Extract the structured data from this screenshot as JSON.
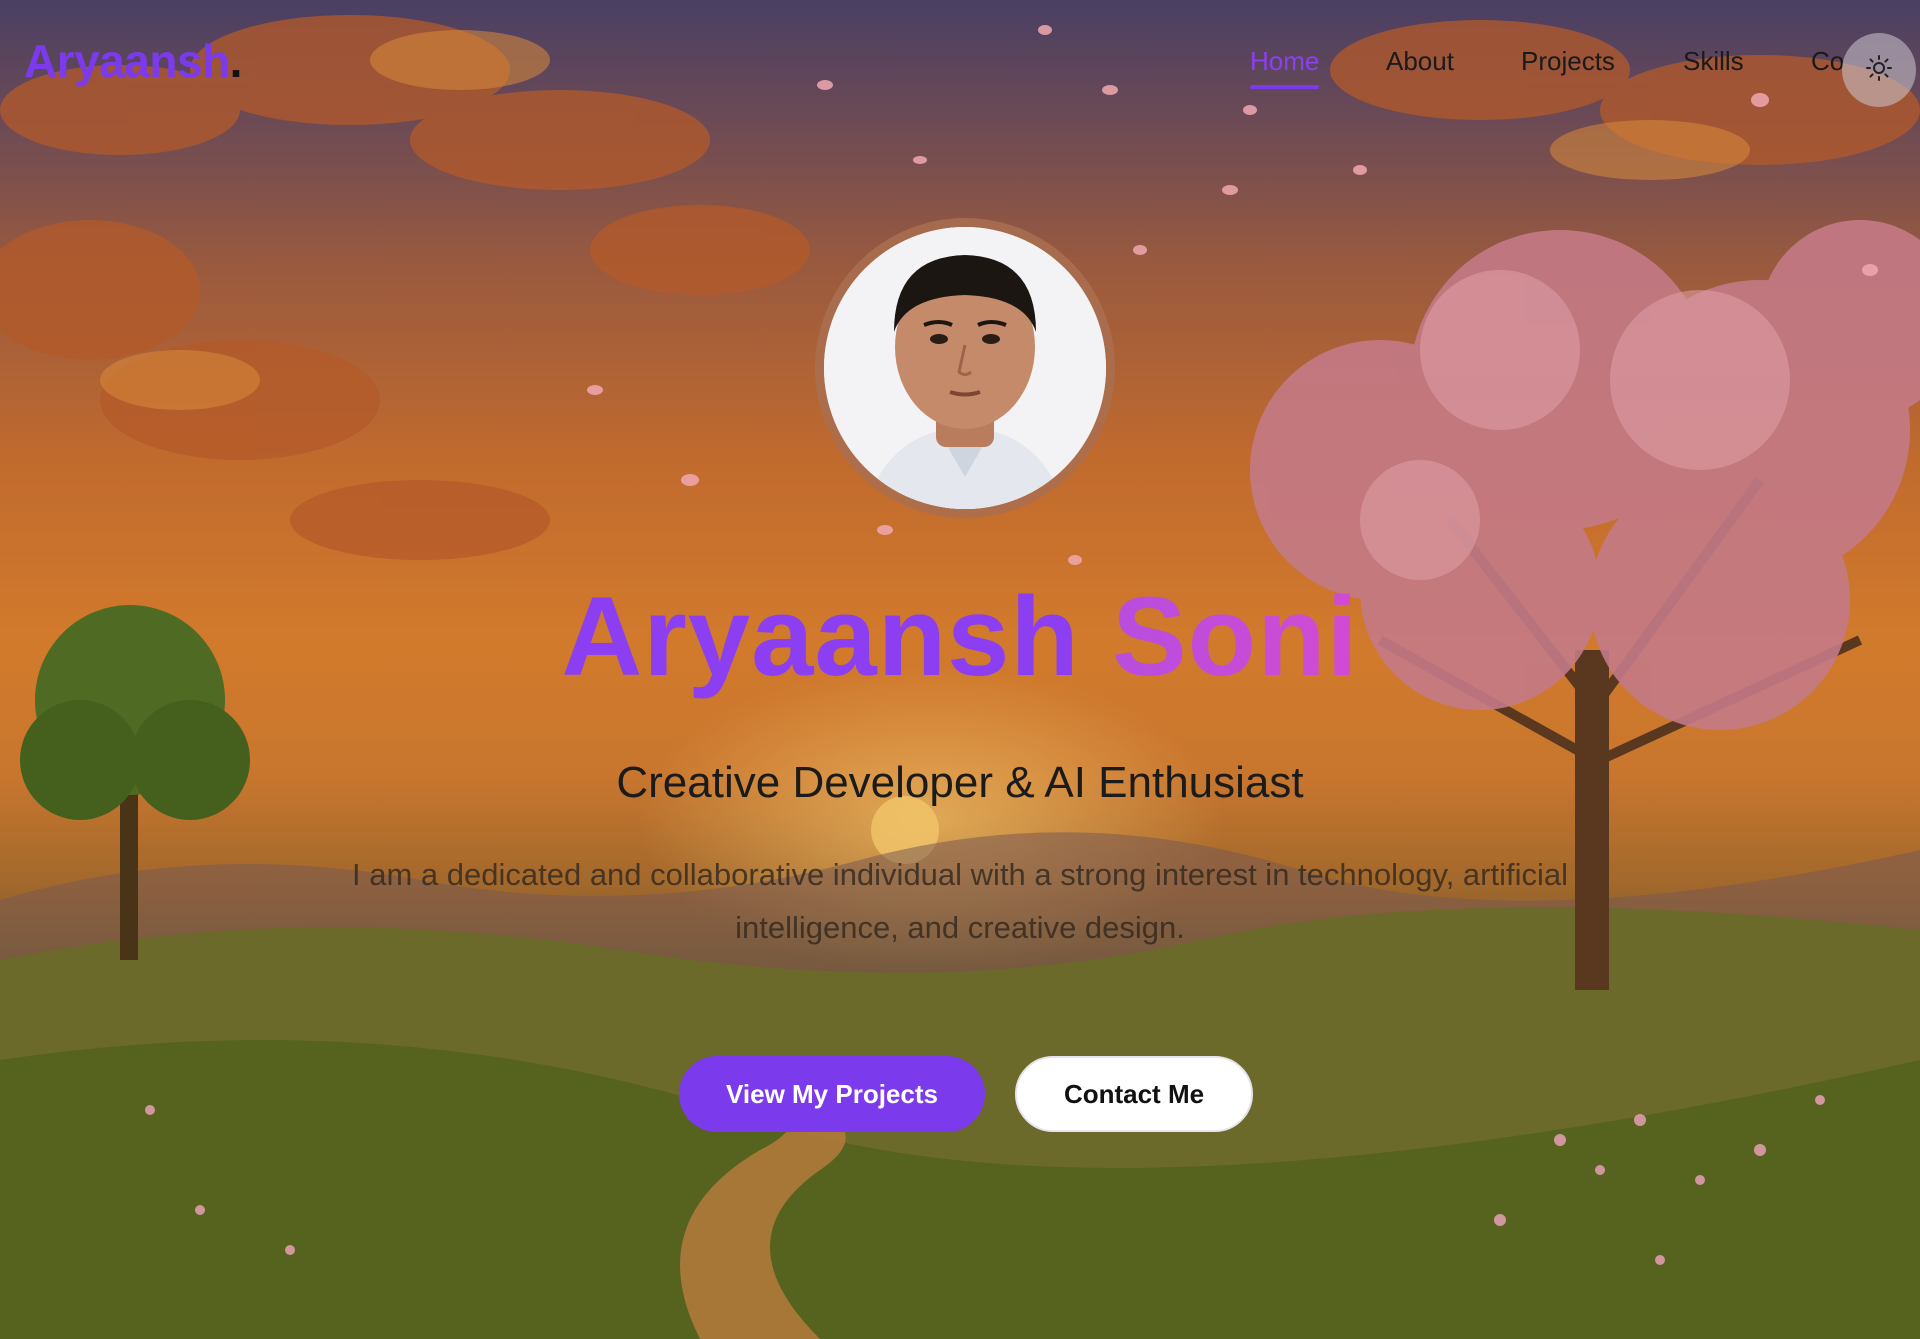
{
  "brand": {
    "name": "Aryaansh",
    "dot": "."
  },
  "nav": {
    "items": [
      {
        "label": "Home",
        "active": true
      },
      {
        "label": "About",
        "active": false
      },
      {
        "label": "Projects",
        "active": false
      },
      {
        "label": "Skills",
        "active": false
      },
      {
        "label": "Co",
        "active": false
      }
    ],
    "theme_toggle_icon": "sun-icon"
  },
  "hero": {
    "avatar_icon": "profile-photo",
    "first_name": "Aryaansh",
    "last_name": "Soni",
    "subtitle": "Creative Developer & AI Enthusiast",
    "description": "I am a dedicated and collaborative individual with a strong interest in technology, artificial intelligence, and creative design.",
    "primary_button": "View My Projects",
    "secondary_button": "Contact Me"
  },
  "colors": {
    "accent": "#7c3aed",
    "accent_gradient_end": "#d24bd2",
    "text_dark": "#1b1b1b"
  }
}
